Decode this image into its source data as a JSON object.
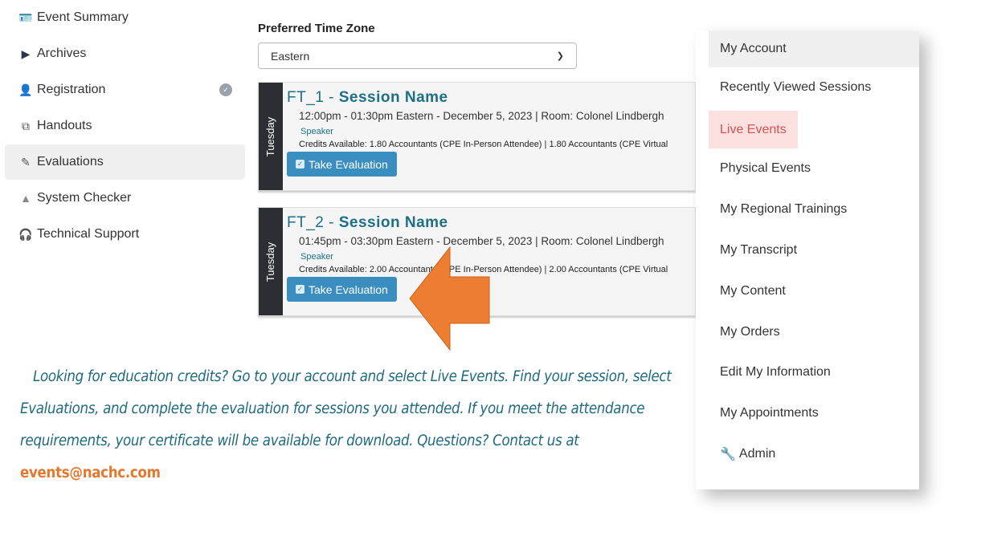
{
  "sidebar": {
    "items": [
      {
        "label": "Event Summary",
        "icon": "id-card-icon"
      },
      {
        "label": "Archives",
        "icon": "play-icon"
      },
      {
        "label": "Registration",
        "icon": "user-plus-icon",
        "badge": "check"
      },
      {
        "label": "Handouts",
        "icon": "copy-icon"
      },
      {
        "label": "Evaluations",
        "icon": "edit-icon",
        "active": true
      },
      {
        "label": "System Checker",
        "icon": "warning-icon"
      },
      {
        "label": "Technical Support",
        "icon": "headset-icon"
      }
    ]
  },
  "timezone": {
    "label": "Preferred Time Zone",
    "value": "Eastern"
  },
  "sessions": [
    {
      "day": "Tuesday",
      "code": "FT_1 -",
      "name": "Session Name",
      "time": "12:00pm - 01:30pm Eastern - December 5, 2023 | Room: Colonel Lindbergh",
      "speaker": "Speaker",
      "credits": "Credits Available: 1.80 Accountants (CPE In-Person Attendee)  |  1.80 Accountants (CPE Virtual",
      "button": "Take Evaluation"
    },
    {
      "day": "Tuesday",
      "code": "FT_2 -",
      "name": "Session Name",
      "time": "01:45pm - 03:30pm Eastern - December 5, 2023 | Room: Colonel Lindbergh",
      "speaker": "Speaker",
      "credits": "Credits Available: 2.00 Accountants (CPE In-Person Attendee)  |  2.00 Accountants (CPE Virtual",
      "button": "Take Evaluation"
    }
  ],
  "menu": {
    "items": [
      "My Account",
      "Recently Viewed Sessions",
      "Live Events",
      "Physical Events",
      "My Regional Trainings",
      "My Transcript",
      "My Content",
      "My Orders",
      "Edit My Information",
      "My Appointments",
      "Admin"
    ],
    "highlighted": "Live Events"
  },
  "message": {
    "text": "Looking for education credits? Go to your account and select Live Events. Find your session, select Evaluations, and complete the evaluation for sessions you attended. If you meet the attendance requirements, your certificate will be available for download. Questions? Contact us at ",
    "email": "events@nachc.com"
  },
  "colors": {
    "accent": "#1e6f86",
    "button": "#3a8ebf",
    "arrow": "#ed7d31",
    "highlight": "#fde0e0"
  }
}
